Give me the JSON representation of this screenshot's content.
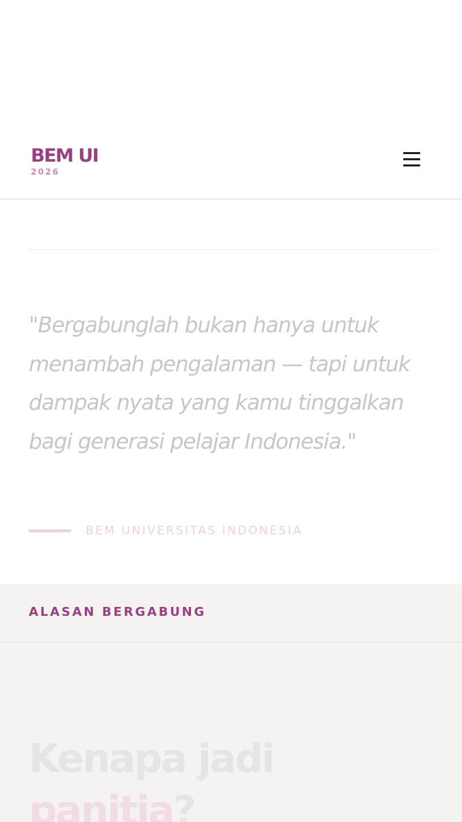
{
  "header": {
    "brand_name": "BEM UI",
    "brand_year": "2026",
    "menu_icon": "hamburger-menu-icon"
  },
  "quote": {
    "text": "\"Bergabunglah bukan hanya untuk menambah pengalaman — tapi untuk dampak nyata yang kamu tinggalkan bagi generasi pelajar Indonesia.\"",
    "author": "BEM UNIVERSITAS INDONESIA"
  },
  "reasons": {
    "label": "ALASAN BERGABUNG",
    "title_part1": "Kenapa jadi",
    "title_accent": "panitia",
    "title_end": "?"
  },
  "colors": {
    "brand": "#9a3f82",
    "brand_light": "#c98bb7",
    "quote_text": "#c6c6c6",
    "author_accent": "#eecfe3",
    "section_bg": "#f4f3f2"
  }
}
